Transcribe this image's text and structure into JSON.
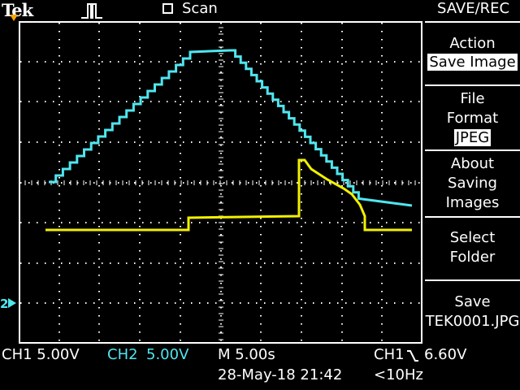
{
  "topbar": {
    "brand": "Tek",
    "trigger_state": "Scan",
    "menu_title": "SAVE/REC"
  },
  "side_menu": {
    "action_title": "Action",
    "action_value": "Save Image",
    "file_format_line1": "File",
    "file_format_line2": "Format",
    "file_format_value": "JPEG",
    "about_line1": "About",
    "about_line2": "Saving",
    "about_line3": "Images",
    "select_line1": "Select",
    "select_line2": "Folder",
    "save_line1": "Save",
    "save_line2": "TEK0001.JPG"
  },
  "marker": {
    "ch2_ground": "2"
  },
  "status": {
    "ch1_scale": "CH1  5.00V",
    "ch2_label": "CH2",
    "ch2_scale": "5.00V",
    "timebase": "M 5.00s",
    "datetime": "28-May-18 21:42",
    "trigger_source": "CH1",
    "trigger_slope_icon": "falling-edge",
    "trigger_level": "6.60V",
    "trigger_freq": "<10Hz"
  },
  "colors": {
    "background": "#000000",
    "grid": "#ffffff",
    "ch1_trace": "#4fe6ef",
    "ch2_trace": "#f2f000"
  }
}
